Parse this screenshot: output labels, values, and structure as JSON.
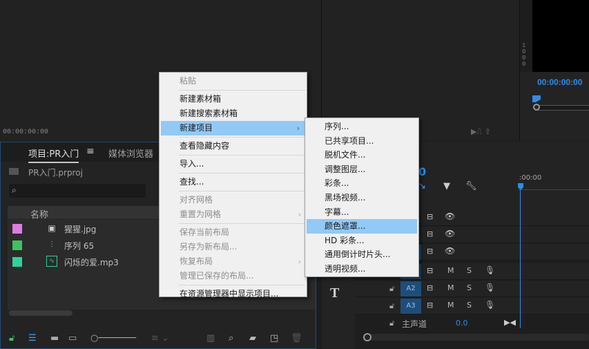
{
  "source_monitor": {
    "timecode": "00:00:00:00"
  },
  "program_monitor": {
    "timecode": "00:00:00:00",
    "ruler_digits": [
      "1",
      "0",
      "0",
      "0"
    ]
  },
  "project_panel": {
    "tabs": [
      {
        "label": "项目:PR入门"
      },
      {
        "label": "媒体浏览器"
      }
    ],
    "menu_icon": "≡",
    "file_name": "PR入门.prproj",
    "column_name": "名称",
    "items": [
      {
        "label": "猩猩.jpg",
        "color": "#e07ae6",
        "icon": "image-file-icon"
      },
      {
        "label": "序列 65",
        "color": "#3ec25e",
        "icon": "sequence-icon"
      },
      {
        "label": "闪烁的爱.mp3",
        "color": "#2ed39a",
        "icon": "audio-file-icon"
      }
    ]
  },
  "timeline": {
    "timecode_fragment": "0",
    "ruler_label": ":00:00",
    "tracks_video": [
      {},
      {},
      {}
    ],
    "tracks_audio": [
      {
        "name": ""
      },
      {
        "name": "A2"
      },
      {
        "name": "A3"
      }
    ],
    "mute_label": "M",
    "solo_label": "S",
    "master_label": "主声道",
    "master_value": "0.0"
  },
  "context_menu": {
    "items": [
      {
        "label": "粘贴",
        "disabled": true
      },
      {
        "separator": true
      },
      {
        "label": "新建素材箱"
      },
      {
        "label": "新建搜索素材箱"
      },
      {
        "label": "新建项目",
        "submenu": true,
        "highlight": true
      },
      {
        "separator": true
      },
      {
        "label": "查看隐藏内容"
      },
      {
        "separator": true
      },
      {
        "label": "导入..."
      },
      {
        "separator": true
      },
      {
        "label": "查找..."
      },
      {
        "separator": true
      },
      {
        "label": "对齐网格",
        "disabled": true
      },
      {
        "label": "重置为网格",
        "disabled": true,
        "submenu": true
      },
      {
        "separator": true
      },
      {
        "label": "保存当前布局",
        "disabled": true
      },
      {
        "label": "另存为新布局...",
        "disabled": true
      },
      {
        "label": "恢复布局",
        "disabled": true,
        "submenu": true
      },
      {
        "label": "管理已保存的布局...",
        "disabled": true
      },
      {
        "separator": true
      },
      {
        "label": "在资源管理器中显示项目..."
      }
    ]
  },
  "submenu": {
    "items": [
      {
        "label": "序列..."
      },
      {
        "label": "已共享项目..."
      },
      {
        "label": "脱机文件..."
      },
      {
        "label": "调整图层..."
      },
      {
        "label": "彩条..."
      },
      {
        "label": "黑场视频..."
      },
      {
        "label": "字幕..."
      },
      {
        "label": "颜色遮罩...",
        "highlight": true
      },
      {
        "label": "HD 彩条..."
      },
      {
        "label": "通用倒计时片头..."
      },
      {
        "label": "透明视频..."
      }
    ]
  },
  "colors": {
    "accent": "#2d8ceb",
    "menu_highlight": "#91c9f7"
  }
}
